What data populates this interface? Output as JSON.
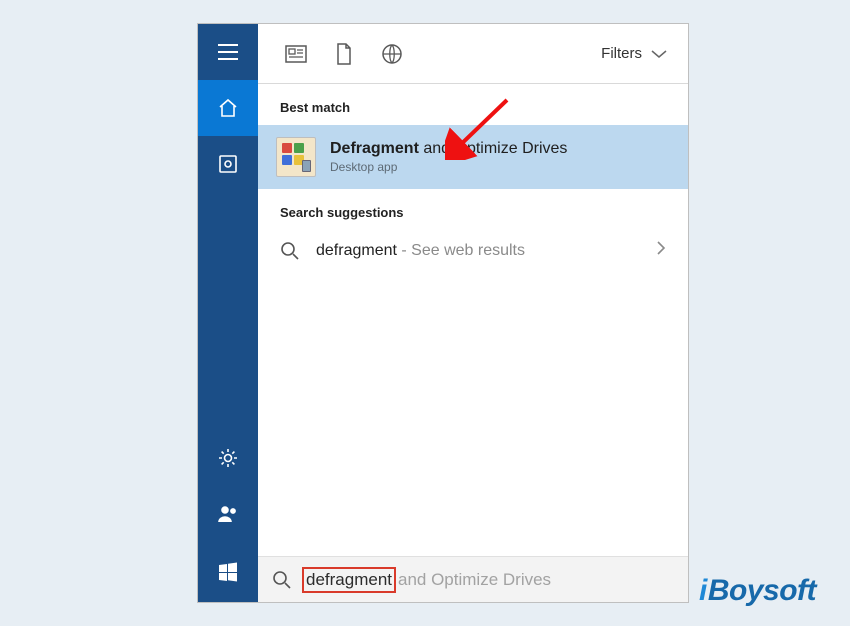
{
  "toolbar": {
    "filters_label": "Filters"
  },
  "sections": {
    "best_match": "Best match",
    "suggestions": "Search suggestions"
  },
  "best_match": {
    "title_bold": "Defragment",
    "title_rest": " and Optimize Drives",
    "subtitle": "Desktop app"
  },
  "suggestion": {
    "term": "defragment",
    "sep": " - ",
    "hint": "See web results"
  },
  "search": {
    "typed": "defragment",
    "completion": "and Optimize Drives"
  },
  "watermark": {
    "prefix": "i",
    "rest": "Boysoft"
  },
  "sidebar": {
    "items": [
      "menu",
      "home",
      "apps",
      "settings",
      "people",
      "start"
    ]
  }
}
